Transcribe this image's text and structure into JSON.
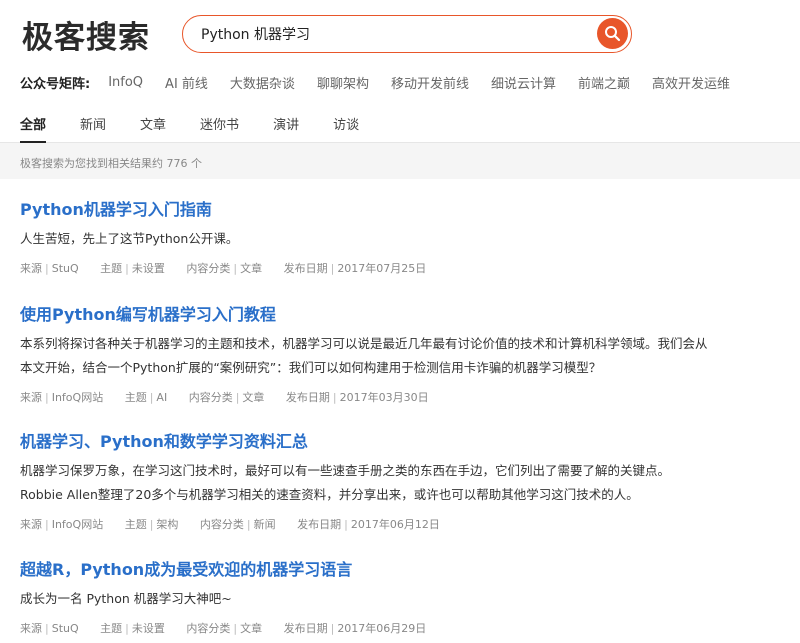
{
  "header": {
    "logo": "极客搜索",
    "search_value": "Python 机器学习"
  },
  "accounts": {
    "label": "公众号矩阵:",
    "items": [
      "InfoQ",
      "AI 前线",
      "大数据杂谈",
      "聊聊架构",
      "移动开发前线",
      "细说云计算",
      "前端之巅",
      "高效开发运维"
    ]
  },
  "tabs": [
    "全部",
    "新闻",
    "文章",
    "迷你书",
    "演讲",
    "访谈"
  ],
  "results_count": "极客搜索为您找到相关结果约 776 个",
  "results": [
    {
      "title": "Python机器学习入门指南",
      "summary": [
        "人生苦短，先上了这节Python公开课。"
      ],
      "meta": {
        "source_label": "来源",
        "source": "StuQ",
        "topic_label": "主题",
        "topic": "未设置",
        "category_label": "内容分类",
        "category": "文章",
        "date_label": "发布日期",
        "date": "2017年07月25日"
      }
    },
    {
      "title": "使用Python编写机器学习入门教程",
      "summary": [
        "本系列将探讨各种关于机器学习的主题和技术，机器学习可以说是最近几年最有讨论价值的技术和计算机科学领域。我们会从",
        "本文开始，结合一个Python扩展的“案例研究”：我们可以如何构建用于检测信用卡诈骗的机器学习模型？"
      ],
      "meta": {
        "source_label": "来源",
        "source": "InfoQ网站",
        "topic_label": "主题",
        "topic": "AI",
        "category_label": "内容分类",
        "category": "文章",
        "date_label": "发布日期",
        "date": "2017年03月30日"
      }
    },
    {
      "title": "机器学习、Python和数学学习资料汇总",
      "summary": [
        "机器学习保罗万象，在学习这门技术时，最好可以有一些速查手册之类的东西在手边，它们列出了需要了解的关键点。",
        "Robbie Allen整理了20多个与机器学习相关的速查资料，并分享出来，或许也可以帮助其他学习这门技术的人。"
      ],
      "meta": {
        "source_label": "来源",
        "source": "InfoQ网站",
        "topic_label": "主题",
        "topic": "架构",
        "category_label": "内容分类",
        "category": "新闻",
        "date_label": "发布日期",
        "date": "2017年06月12日"
      }
    },
    {
      "title": "超越R，Python成为最受欢迎的机器学习语言",
      "summary": [
        "成长为一名 Python 机器学习大神吧~"
      ],
      "meta": {
        "source_label": "来源",
        "source": "StuQ",
        "topic_label": "主题",
        "topic": "未设置",
        "category_label": "内容分类",
        "category": "文章",
        "date_label": "发布日期",
        "date": "2017年06月29日"
      }
    }
  ],
  "colors": {
    "accent": "#e8562a",
    "link": "#2a6fc9"
  },
  "icons": {
    "search_button": "search-icon"
  }
}
